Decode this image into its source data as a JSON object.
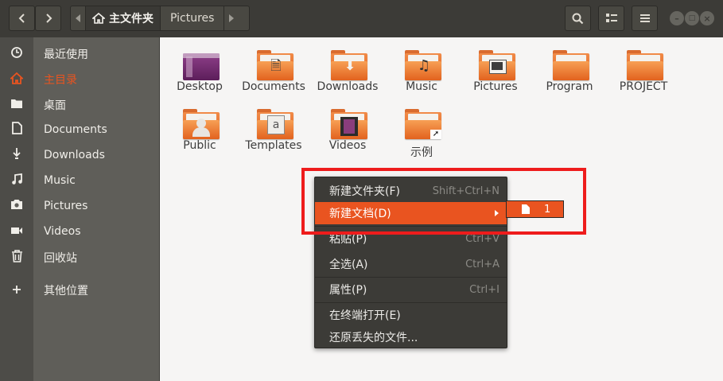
{
  "header": {
    "back_icon": "chevron-left",
    "forward_icon": "chevron-right",
    "crumb_home": "主文件夹",
    "crumb_current": "Pictures"
  },
  "sidebar": {
    "items": [
      {
        "label": "最近使用",
        "icon": "clock-icon"
      },
      {
        "label": "主目录",
        "icon": "home-icon"
      },
      {
        "label": "桌面",
        "icon": "folder-icon"
      },
      {
        "label": "Documents",
        "icon": "document-icon"
      },
      {
        "label": "Downloads",
        "icon": "download-icon"
      },
      {
        "label": "Music",
        "icon": "music-icon"
      },
      {
        "label": "Pictures",
        "icon": "camera-icon"
      },
      {
        "label": "Videos",
        "icon": "video-icon"
      },
      {
        "label": "回收站",
        "icon": "trash-icon"
      },
      {
        "label": "其他位置",
        "icon": "plus-icon"
      }
    ]
  },
  "folders": [
    {
      "label": "Desktop"
    },
    {
      "label": "Documents"
    },
    {
      "label": "Downloads"
    },
    {
      "label": "Music"
    },
    {
      "label": "Pictures"
    },
    {
      "label": "Program"
    },
    {
      "label": "PROJECT"
    },
    {
      "label": "Public"
    },
    {
      "label": "Templates"
    },
    {
      "label": "Videos"
    },
    {
      "label": "示例"
    }
  ],
  "context_menu": {
    "items": [
      {
        "label": "新建文件夹(F)",
        "accel": "Shift+Ctrl+N"
      },
      {
        "label": "新建文档(D)",
        "accel": ""
      },
      {
        "label": "粘贴(P)",
        "accel": "Ctrl+V"
      },
      {
        "label": "全选(A)",
        "accel": "Ctrl+A"
      },
      {
        "label": "属性(P)",
        "accel": "Ctrl+I"
      },
      {
        "label": "在终端打开(E)",
        "accel": ""
      },
      {
        "label": "还原丢失的文件...",
        "accel": ""
      }
    ],
    "submenu_item": "1"
  },
  "colors": {
    "accent": "#e95420",
    "highlight_box": "#ee1c1c"
  }
}
